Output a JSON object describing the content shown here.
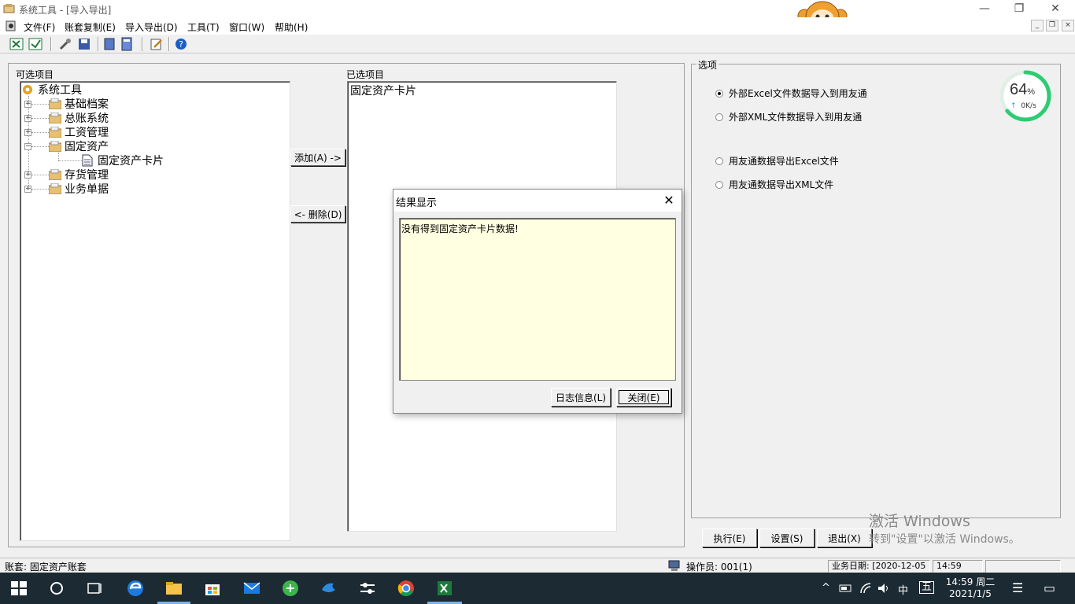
{
  "window": {
    "title": "系统工具 - [导入导出]",
    "minimize_glyph": "—",
    "restore_glyph": "❐",
    "close_glyph": "✕"
  },
  "menu": [
    "文件(F)",
    "账套复制(E)",
    "导入导出(D)",
    "工具(T)",
    "窗口(W)",
    "帮助(H)"
  ],
  "left_panel": {
    "label": "可选项目",
    "root": "系统工具",
    "items": [
      {
        "label": "基础档案",
        "expander": "+"
      },
      {
        "label": "总账系统",
        "expander": "+"
      },
      {
        "label": "工资管理",
        "expander": "+"
      },
      {
        "label": "固定资产",
        "expander": "−"
      },
      {
        "label": "固定资产卡片",
        "expander": ""
      },
      {
        "label": "存货管理",
        "expander": "+"
      },
      {
        "label": "业务单据",
        "expander": "+"
      }
    ]
  },
  "buttons": {
    "add": "添加(A) ->",
    "delete": "<- 删除(D)"
  },
  "right_list": {
    "label": "已选项目",
    "items": [
      "固定资产卡片"
    ]
  },
  "options": {
    "label": "选项",
    "items": [
      {
        "label": "外部Excel文件数据导入到用友通",
        "checked": true
      },
      {
        "label": "外部XML文件数据导入到用友通",
        "checked": false
      },
      {
        "label": "用友通数据导出Excel文件",
        "checked": false
      },
      {
        "label": "用友通数据导出XML文件",
        "checked": false
      }
    ]
  },
  "network_widget": {
    "percent": "64",
    "percent_sign": "%",
    "speed": "0K/s",
    "arrow": "↑",
    "level": 0.64,
    "accent": "#2ecc71"
  },
  "bottom_buttons": {
    "execute": "执行(E)",
    "settings": "设置(S)",
    "exit": "退出(X)"
  },
  "dialog": {
    "title": "结果显示",
    "message": "没有得到固定资产卡片数据!",
    "log_button": "日志信息(L)",
    "close_button": "关闭(E)",
    "close_glyph": "✕",
    "text_bg": "#ffffe1"
  },
  "statusbar": {
    "account": "账套: 固定资产账套",
    "operator": "操作员: 001(1)",
    "date": "业务日期: [2020-12-05",
    "time": "14:59"
  },
  "watermark": {
    "line1": "激活 Windows",
    "line2": "转到\"设置\"以激活 Windows。"
  },
  "taskbar": {
    "time": "14:59 周二",
    "date": "2021/1/5",
    "ime": "中",
    "ime2": "五",
    "caret": "^",
    "notify_glyph": "☰",
    "desktop_glyph": "▭"
  }
}
